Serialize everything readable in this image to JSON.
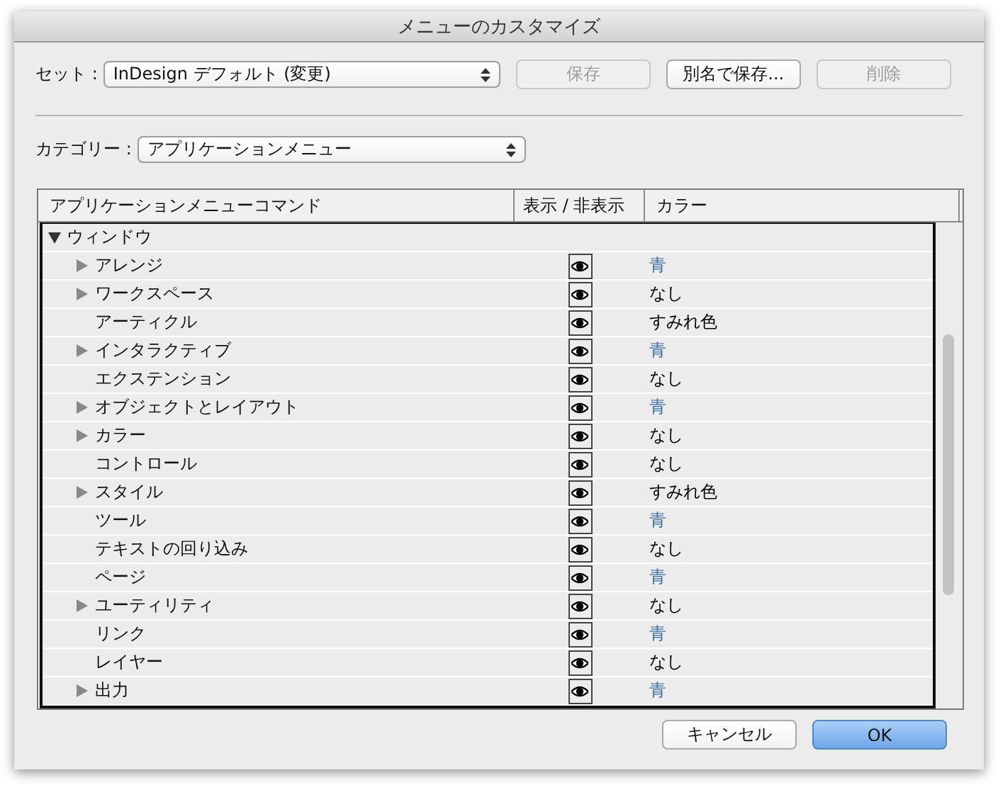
{
  "window": {
    "title": "メニューのカスタマイズ"
  },
  "set": {
    "label": "セット :",
    "value": "InDesign デフォルト (変更)"
  },
  "set_buttons": [
    {
      "label": "保存",
      "disabled": true
    },
    {
      "label": "別名で保存...",
      "disabled": false
    },
    {
      "label": "削除",
      "disabled": true
    }
  ],
  "category": {
    "label": "カテゴリー :",
    "value": "アプリケーションメニュー"
  },
  "table": {
    "columns": [
      "アプリケーションメニューコマンド",
      "表示 / 非表示",
      "カラー"
    ],
    "rows": [
      {
        "label": "ウィンドウ",
        "kind": "group",
        "expanded": true,
        "children": [
          {
            "label": "アレンジ",
            "kind": "submenu",
            "expanded": false,
            "visible": true,
            "color_name": "青",
            "color": "#3b6fa8"
          },
          {
            "label": "ワークスペース",
            "kind": "submenu",
            "expanded": false,
            "visible": true,
            "color_name": "なし",
            "color": "#000000"
          },
          {
            "label": "アーティクル",
            "kind": "command",
            "visible": true,
            "color_name": "すみれ色",
            "color": "#000000"
          },
          {
            "label": "インタラクティブ",
            "kind": "submenu",
            "expanded": false,
            "visible": true,
            "color_name": "青",
            "color": "#3b6fa8"
          },
          {
            "label": "エクステンション",
            "kind": "command",
            "visible": true,
            "color_name": "なし",
            "color": "#000000"
          },
          {
            "label": "オブジェクトとレイアウト",
            "kind": "submenu",
            "expanded": false,
            "visible": true,
            "color_name": "青",
            "color": "#3b6fa8"
          },
          {
            "label": "カラー",
            "kind": "submenu",
            "expanded": false,
            "visible": true,
            "color_name": "なし",
            "color": "#000000"
          },
          {
            "label": "コントロール",
            "kind": "command",
            "visible": true,
            "color_name": "なし",
            "color": "#000000"
          },
          {
            "label": "スタイル",
            "kind": "submenu",
            "expanded": false,
            "visible": true,
            "color_name": "すみれ色",
            "color": "#000000"
          },
          {
            "label": "ツール",
            "kind": "command",
            "visible": true,
            "color_name": "青",
            "color": "#3b6fa8"
          },
          {
            "label": "テキストの回り込み",
            "kind": "command",
            "visible": true,
            "color_name": "なし",
            "color": "#000000"
          },
          {
            "label": "ページ",
            "kind": "command",
            "visible": true,
            "color_name": "青",
            "color": "#3b6fa8"
          },
          {
            "label": "ユーティリティ",
            "kind": "submenu",
            "expanded": false,
            "visible": true,
            "color_name": "なし",
            "color": "#000000"
          },
          {
            "label": "リンク",
            "kind": "command",
            "visible": true,
            "color_name": "青",
            "color": "#3b6fa8"
          },
          {
            "label": "レイヤー",
            "kind": "command",
            "visible": true,
            "color_name": "なし",
            "color": "#000000"
          },
          {
            "label": "出力",
            "kind": "submenu",
            "expanded": false,
            "visible": true,
            "color_name": "青",
            "color": "#3b6fa8"
          }
        ]
      }
    ]
  },
  "buttons": [
    {
      "label": "キャンセル",
      "default": false
    },
    {
      "label": "OK",
      "default": true
    }
  ]
}
